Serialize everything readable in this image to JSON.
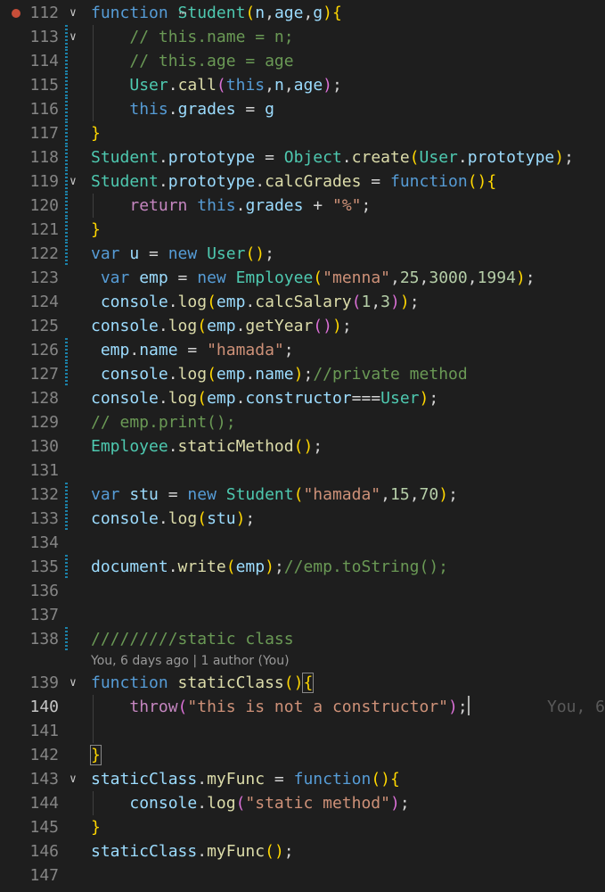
{
  "editor": {
    "codelens": "You, 6 days ago | 1 author (You)",
    "ghost_blame": "You, 6",
    "lines": [
      {
        "num": "112",
        "fold": "∨",
        "breakpoint": true,
        "tokens": [
          {
            "t": "function",
            "c": "kw"
          },
          {
            "t": " ",
            "c": "plain"
          },
          {
            "t": "Student",
            "c": "cls"
          },
          {
            "t": "(",
            "c": "p1"
          },
          {
            "t": "n",
            "c": "var"
          },
          {
            "t": ",",
            "c": "plain"
          },
          {
            "t": "age",
            "c": "var"
          },
          {
            "t": ",",
            "c": "plain"
          },
          {
            "t": "g",
            "c": "var"
          },
          {
            "t": ")",
            "c": "p1"
          },
          {
            "t": "{",
            "c": "p1"
          }
        ]
      },
      {
        "num": "113",
        "fold": "∨",
        "bar": true,
        "guide": true,
        "tokens": [
          {
            "t": "    ",
            "c": "plain"
          },
          {
            "t": "// this.name = n;",
            "c": "cmt"
          }
        ]
      },
      {
        "num": "114",
        "bar": true,
        "guide": true,
        "tokens": [
          {
            "t": "    ",
            "c": "plain"
          },
          {
            "t": "// this.age = age",
            "c": "cmt"
          }
        ]
      },
      {
        "num": "115",
        "bar": true,
        "guide": true,
        "tokens": [
          {
            "t": "    ",
            "c": "plain"
          },
          {
            "t": "User",
            "c": "cls"
          },
          {
            "t": ".",
            "c": "plain"
          },
          {
            "t": "call",
            "c": "fn"
          },
          {
            "t": "(",
            "c": "p2"
          },
          {
            "t": "this",
            "c": "kw"
          },
          {
            "t": ",",
            "c": "plain"
          },
          {
            "t": "n",
            "c": "var"
          },
          {
            "t": ",",
            "c": "plain"
          },
          {
            "t": "age",
            "c": "var"
          },
          {
            "t": ")",
            "c": "p2"
          },
          {
            "t": ";",
            "c": "plain"
          }
        ]
      },
      {
        "num": "116",
        "bar": true,
        "guide": true,
        "tokens": [
          {
            "t": "    ",
            "c": "plain"
          },
          {
            "t": "this",
            "c": "kw"
          },
          {
            "t": ".",
            "c": "plain"
          },
          {
            "t": "grades",
            "c": "var"
          },
          {
            "t": " = ",
            "c": "plain"
          },
          {
            "t": "g",
            "c": "var"
          }
        ]
      },
      {
        "num": "117",
        "bar": true,
        "tokens": [
          {
            "t": "}",
            "c": "p1"
          }
        ]
      },
      {
        "num": "118",
        "bar": true,
        "tokens": [
          {
            "t": "Student",
            "c": "cls"
          },
          {
            "t": ".",
            "c": "plain"
          },
          {
            "t": "prototype",
            "c": "var"
          },
          {
            "t": " = ",
            "c": "plain"
          },
          {
            "t": "Object",
            "c": "cls"
          },
          {
            "t": ".",
            "c": "plain"
          },
          {
            "t": "create",
            "c": "fn"
          },
          {
            "t": "(",
            "c": "p1"
          },
          {
            "t": "User",
            "c": "cls"
          },
          {
            "t": ".",
            "c": "plain"
          },
          {
            "t": "prototype",
            "c": "var"
          },
          {
            "t": ")",
            "c": "p1"
          },
          {
            "t": ";",
            "c": "plain"
          }
        ]
      },
      {
        "num": "119",
        "fold": "∨",
        "bar": true,
        "tokens": [
          {
            "t": "Student",
            "c": "cls"
          },
          {
            "t": ".",
            "c": "plain"
          },
          {
            "t": "prototype",
            "c": "var"
          },
          {
            "t": ".",
            "c": "plain"
          },
          {
            "t": "calcGrades",
            "c": "fn"
          },
          {
            "t": " = ",
            "c": "plain"
          },
          {
            "t": "function",
            "c": "kw"
          },
          {
            "t": "(",
            "c": "p1"
          },
          {
            "t": ")",
            "c": "p1"
          },
          {
            "t": "{",
            "c": "p1"
          }
        ]
      },
      {
        "num": "120",
        "bar": true,
        "guide": true,
        "tokens": [
          {
            "t": "    ",
            "c": "plain"
          },
          {
            "t": "return",
            "c": "ctl"
          },
          {
            "t": " ",
            "c": "plain"
          },
          {
            "t": "this",
            "c": "kw"
          },
          {
            "t": ".",
            "c": "plain"
          },
          {
            "t": "grades",
            "c": "var"
          },
          {
            "t": " + ",
            "c": "plain"
          },
          {
            "t": "\"%\"",
            "c": "str"
          },
          {
            "t": ";",
            "c": "plain"
          }
        ]
      },
      {
        "num": "121",
        "bar": true,
        "tokens": [
          {
            "t": "}",
            "c": "p1"
          }
        ]
      },
      {
        "num": "122",
        "bar": true,
        "tokens": [
          {
            "t": "var",
            "c": "kw"
          },
          {
            "t": " ",
            "c": "plain"
          },
          {
            "t": "u",
            "c": "var"
          },
          {
            "t": " = ",
            "c": "plain"
          },
          {
            "t": "new",
            "c": "kw"
          },
          {
            "t": " ",
            "c": "plain"
          },
          {
            "t": "User",
            "c": "cls"
          },
          {
            "t": "(",
            "c": "p1"
          },
          {
            "t": ")",
            "c": "p1"
          },
          {
            "t": ";",
            "c": "plain"
          }
        ]
      },
      {
        "num": "123",
        "tokens": [
          {
            "t": " ",
            "c": "plain"
          },
          {
            "t": "var",
            "c": "kw"
          },
          {
            "t": " ",
            "c": "plain"
          },
          {
            "t": "emp",
            "c": "var"
          },
          {
            "t": " = ",
            "c": "plain"
          },
          {
            "t": "new",
            "c": "kw"
          },
          {
            "t": " ",
            "c": "plain"
          },
          {
            "t": "Employee",
            "c": "cls"
          },
          {
            "t": "(",
            "c": "p1"
          },
          {
            "t": "\"menna\"",
            "c": "str"
          },
          {
            "t": ",",
            "c": "plain"
          },
          {
            "t": "25",
            "c": "num"
          },
          {
            "t": ",",
            "c": "plain"
          },
          {
            "t": "3000",
            "c": "num"
          },
          {
            "t": ",",
            "c": "plain"
          },
          {
            "t": "1994",
            "c": "num"
          },
          {
            "t": ")",
            "c": "p1"
          },
          {
            "t": ";",
            "c": "plain"
          }
        ]
      },
      {
        "num": "124",
        "tokens": [
          {
            "t": " ",
            "c": "plain"
          },
          {
            "t": "console",
            "c": "var"
          },
          {
            "t": ".",
            "c": "plain"
          },
          {
            "t": "log",
            "c": "fn"
          },
          {
            "t": "(",
            "c": "p1"
          },
          {
            "t": "emp",
            "c": "var"
          },
          {
            "t": ".",
            "c": "plain"
          },
          {
            "t": "calcSalary",
            "c": "fn"
          },
          {
            "t": "(",
            "c": "p2"
          },
          {
            "t": "1",
            "c": "num"
          },
          {
            "t": ",",
            "c": "plain"
          },
          {
            "t": "3",
            "c": "num"
          },
          {
            "t": ")",
            "c": "p2"
          },
          {
            "t": ")",
            "c": "p1"
          },
          {
            "t": ";",
            "c": "plain"
          }
        ]
      },
      {
        "num": "125",
        "tokens": [
          {
            "t": "console",
            "c": "var"
          },
          {
            "t": ".",
            "c": "plain"
          },
          {
            "t": "log",
            "c": "fn"
          },
          {
            "t": "(",
            "c": "p1"
          },
          {
            "t": "emp",
            "c": "var"
          },
          {
            "t": ".",
            "c": "plain"
          },
          {
            "t": "getYear",
            "c": "fn"
          },
          {
            "t": "(",
            "c": "p2"
          },
          {
            "t": ")",
            "c": "p2"
          },
          {
            "t": ")",
            "c": "p1"
          },
          {
            "t": ";",
            "c": "plain"
          }
        ]
      },
      {
        "num": "126",
        "bar": true,
        "tokens": [
          {
            "t": " ",
            "c": "plain"
          },
          {
            "t": "emp",
            "c": "var"
          },
          {
            "t": ".",
            "c": "plain"
          },
          {
            "t": "name",
            "c": "var"
          },
          {
            "t": " = ",
            "c": "plain"
          },
          {
            "t": "\"hamada\"",
            "c": "str"
          },
          {
            "t": ";",
            "c": "plain"
          }
        ]
      },
      {
        "num": "127",
        "bar": true,
        "tokens": [
          {
            "t": " ",
            "c": "plain"
          },
          {
            "t": "console",
            "c": "var"
          },
          {
            "t": ".",
            "c": "plain"
          },
          {
            "t": "log",
            "c": "fn"
          },
          {
            "t": "(",
            "c": "p1"
          },
          {
            "t": "emp",
            "c": "var"
          },
          {
            "t": ".",
            "c": "plain"
          },
          {
            "t": "name",
            "c": "var"
          },
          {
            "t": ")",
            "c": "p1"
          },
          {
            "t": ";",
            "c": "plain"
          },
          {
            "t": "//private method",
            "c": "cmt"
          }
        ]
      },
      {
        "num": "128",
        "tokens": [
          {
            "t": "console",
            "c": "var"
          },
          {
            "t": ".",
            "c": "plain"
          },
          {
            "t": "log",
            "c": "fn"
          },
          {
            "t": "(",
            "c": "p1"
          },
          {
            "t": "emp",
            "c": "var"
          },
          {
            "t": ".",
            "c": "plain"
          },
          {
            "t": "constructor",
            "c": "var"
          },
          {
            "t": "===",
            "c": "plain"
          },
          {
            "t": "User",
            "c": "cls"
          },
          {
            "t": ")",
            "c": "p1"
          },
          {
            "t": ";",
            "c": "plain"
          }
        ]
      },
      {
        "num": "129",
        "tokens": [
          {
            "t": "// emp.print();",
            "c": "cmt"
          }
        ]
      },
      {
        "num": "130",
        "tokens": [
          {
            "t": "Employee",
            "c": "cls"
          },
          {
            "t": ".",
            "c": "plain"
          },
          {
            "t": "staticMethod",
            "c": "fn"
          },
          {
            "t": "(",
            "c": "p1"
          },
          {
            "t": ")",
            "c": "p1"
          },
          {
            "t": ";",
            "c": "plain"
          }
        ]
      },
      {
        "num": "131",
        "tokens": []
      },
      {
        "num": "132",
        "bar": true,
        "tokens": [
          {
            "t": "var",
            "c": "kw"
          },
          {
            "t": " ",
            "c": "plain"
          },
          {
            "t": "stu",
            "c": "var"
          },
          {
            "t": " = ",
            "c": "plain"
          },
          {
            "t": "new",
            "c": "kw"
          },
          {
            "t": " ",
            "c": "plain"
          },
          {
            "t": "Student",
            "c": "cls"
          },
          {
            "t": "(",
            "c": "p1"
          },
          {
            "t": "\"hamada\"",
            "c": "str"
          },
          {
            "t": ",",
            "c": "plain"
          },
          {
            "t": "15",
            "c": "num"
          },
          {
            "t": ",",
            "c": "plain"
          },
          {
            "t": "70",
            "c": "num"
          },
          {
            "t": ")",
            "c": "p1"
          },
          {
            "t": ";",
            "c": "plain"
          }
        ]
      },
      {
        "num": "133",
        "bar": true,
        "tokens": [
          {
            "t": "console",
            "c": "var"
          },
          {
            "t": ".",
            "c": "plain"
          },
          {
            "t": "log",
            "c": "fn"
          },
          {
            "t": "(",
            "c": "p1"
          },
          {
            "t": "stu",
            "c": "var"
          },
          {
            "t": ")",
            "c": "p1"
          },
          {
            "t": ";",
            "c": "plain"
          }
        ]
      },
      {
        "num": "134",
        "tokens": []
      },
      {
        "num": "135",
        "bar": true,
        "tokens": [
          {
            "t": "document",
            "c": "var"
          },
          {
            "t": ".",
            "c": "plain"
          },
          {
            "t": "write",
            "c": "fn"
          },
          {
            "t": "(",
            "c": "p1"
          },
          {
            "t": "emp",
            "c": "var"
          },
          {
            "t": ")",
            "c": "p1"
          },
          {
            "t": ";",
            "c": "plain"
          },
          {
            "t": "//emp.toString();",
            "c": "cmt"
          }
        ]
      },
      {
        "num": "136",
        "tokens": []
      },
      {
        "num": "137",
        "tokens": []
      },
      {
        "num": "138",
        "bar": true,
        "tokens": [
          {
            "t": "/////////static class",
            "c": "cmt"
          }
        ]
      },
      {
        "lens": true
      },
      {
        "num": "139",
        "fold": "∨",
        "tokens": [
          {
            "t": "function",
            "c": "kw"
          },
          {
            "t": " ",
            "c": "plain"
          },
          {
            "t": "staticClass",
            "c": "fn"
          },
          {
            "t": "(",
            "c": "p1"
          },
          {
            "t": ")",
            "c": "p1"
          },
          {
            "t": "{",
            "c": "p1",
            "bm": true
          }
        ]
      },
      {
        "num": "140",
        "active": true,
        "guide": true,
        "cursor": true,
        "ghost": true,
        "tokens": [
          {
            "t": "    ",
            "c": "plain"
          },
          {
            "t": "throw",
            "c": "ctl"
          },
          {
            "t": "(",
            "c": "p2"
          },
          {
            "t": "\"this is not a constructor\"",
            "c": "str"
          },
          {
            "t": ")",
            "c": "p2"
          },
          {
            "t": ";",
            "c": "plain"
          }
        ]
      },
      {
        "num": "141",
        "guide": true,
        "tokens": []
      },
      {
        "num": "142",
        "tokens": [
          {
            "t": "}",
            "c": "p1",
            "bm": true
          }
        ]
      },
      {
        "num": "143",
        "fold": "∨",
        "tokens": [
          {
            "t": "staticClass",
            "c": "var"
          },
          {
            "t": ".",
            "c": "plain"
          },
          {
            "t": "myFunc",
            "c": "fn"
          },
          {
            "t": " = ",
            "c": "plain"
          },
          {
            "t": "function",
            "c": "kw"
          },
          {
            "t": "(",
            "c": "p1"
          },
          {
            "t": ")",
            "c": "p1"
          },
          {
            "t": "{",
            "c": "p1"
          }
        ]
      },
      {
        "num": "144",
        "guide": true,
        "tokens": [
          {
            "t": "    ",
            "c": "plain"
          },
          {
            "t": "console",
            "c": "var"
          },
          {
            "t": ".",
            "c": "plain"
          },
          {
            "t": "log",
            "c": "fn"
          },
          {
            "t": "(",
            "c": "p2"
          },
          {
            "t": "\"static method\"",
            "c": "str"
          },
          {
            "t": ")",
            "c": "p2"
          },
          {
            "t": ";",
            "c": "plain"
          }
        ]
      },
      {
        "num": "145",
        "tokens": [
          {
            "t": "}",
            "c": "p1"
          }
        ]
      },
      {
        "num": "146",
        "tokens": [
          {
            "t": "staticClass",
            "c": "var"
          },
          {
            "t": ".",
            "c": "plain"
          },
          {
            "t": "myFunc",
            "c": "fn"
          },
          {
            "t": "(",
            "c": "p1"
          },
          {
            "t": ")",
            "c": "p1"
          },
          {
            "t": ";",
            "c": "plain"
          }
        ]
      },
      {
        "num": "147",
        "tokens": []
      }
    ]
  }
}
